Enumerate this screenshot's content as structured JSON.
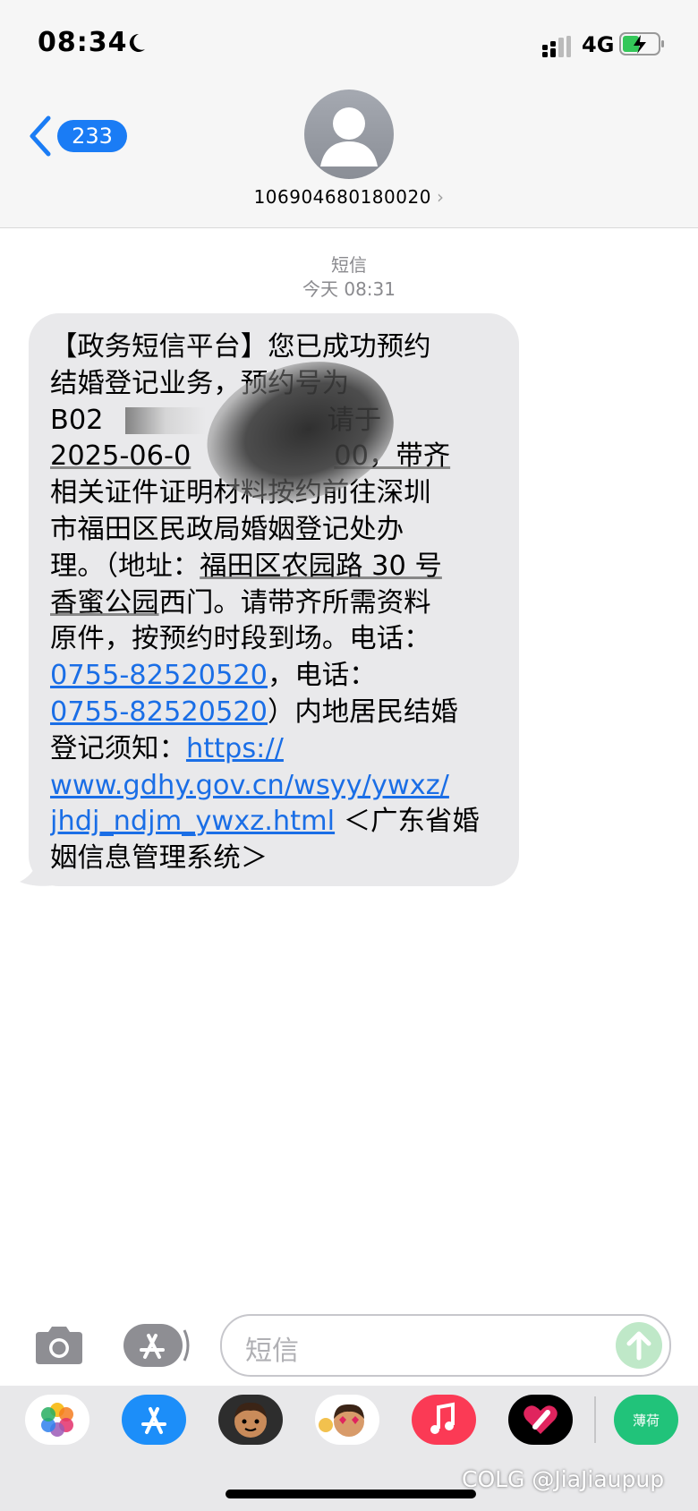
{
  "status_bar": {
    "time": "08:34",
    "network": "4G",
    "icons": [
      "moon-icon",
      "signal-icon",
      "battery-charging-icon"
    ]
  },
  "header": {
    "back_badge": "233",
    "contact_number": "106904680180020",
    "contact_chevron": "›"
  },
  "conversation": {
    "service": "短信",
    "timestamp": "今天 08:31",
    "message_lines": [
      "【政务短信平台】您已成功预约",
      "结婚登记业务，预约号为",
      "B02",
      "2025-06-0",
      "相关证件证明材料按约前往深圳",
      "市福田区民政局婚姻登记处办",
      "理。（地址：",
      "香蜜公园",
      "原件，按预约时段到场。电话：",
      "0755-82520520",
      "0755-82520520",
      "登记须知：",
      "https://",
      "www.gdhy.gov.cn/wsyy/ywxz/",
      "jhdj_ndjm_ywxz.html",
      "姻信息管理系统＞"
    ],
    "fragments": {
      "l3_end": "请于",
      "l4_end": "00，带齐",
      "l7_link": "福田区农园路 30 号",
      "l8_tail": "西门。请带齐所需资料",
      "l10_tail": "，电话：",
      "l11_tail": "）内地居民结婚",
      "l15_tail": " ＜广东省婚"
    }
  },
  "compose": {
    "placeholder": "短信"
  },
  "app_drawer": {
    "apps": [
      "Photos",
      "App Store",
      "Memoji",
      "Animoji",
      "Music",
      "Digital Touch",
      "薄荷"
    ],
    "peppermint_label": "薄荷"
  },
  "watermark": "COLG @JiaJiaupup",
  "colors": {
    "accent": "#1a7cf5",
    "bubble": "#e9e9eb",
    "link": "#1a6ee6",
    "send": "#bfe8c8"
  }
}
